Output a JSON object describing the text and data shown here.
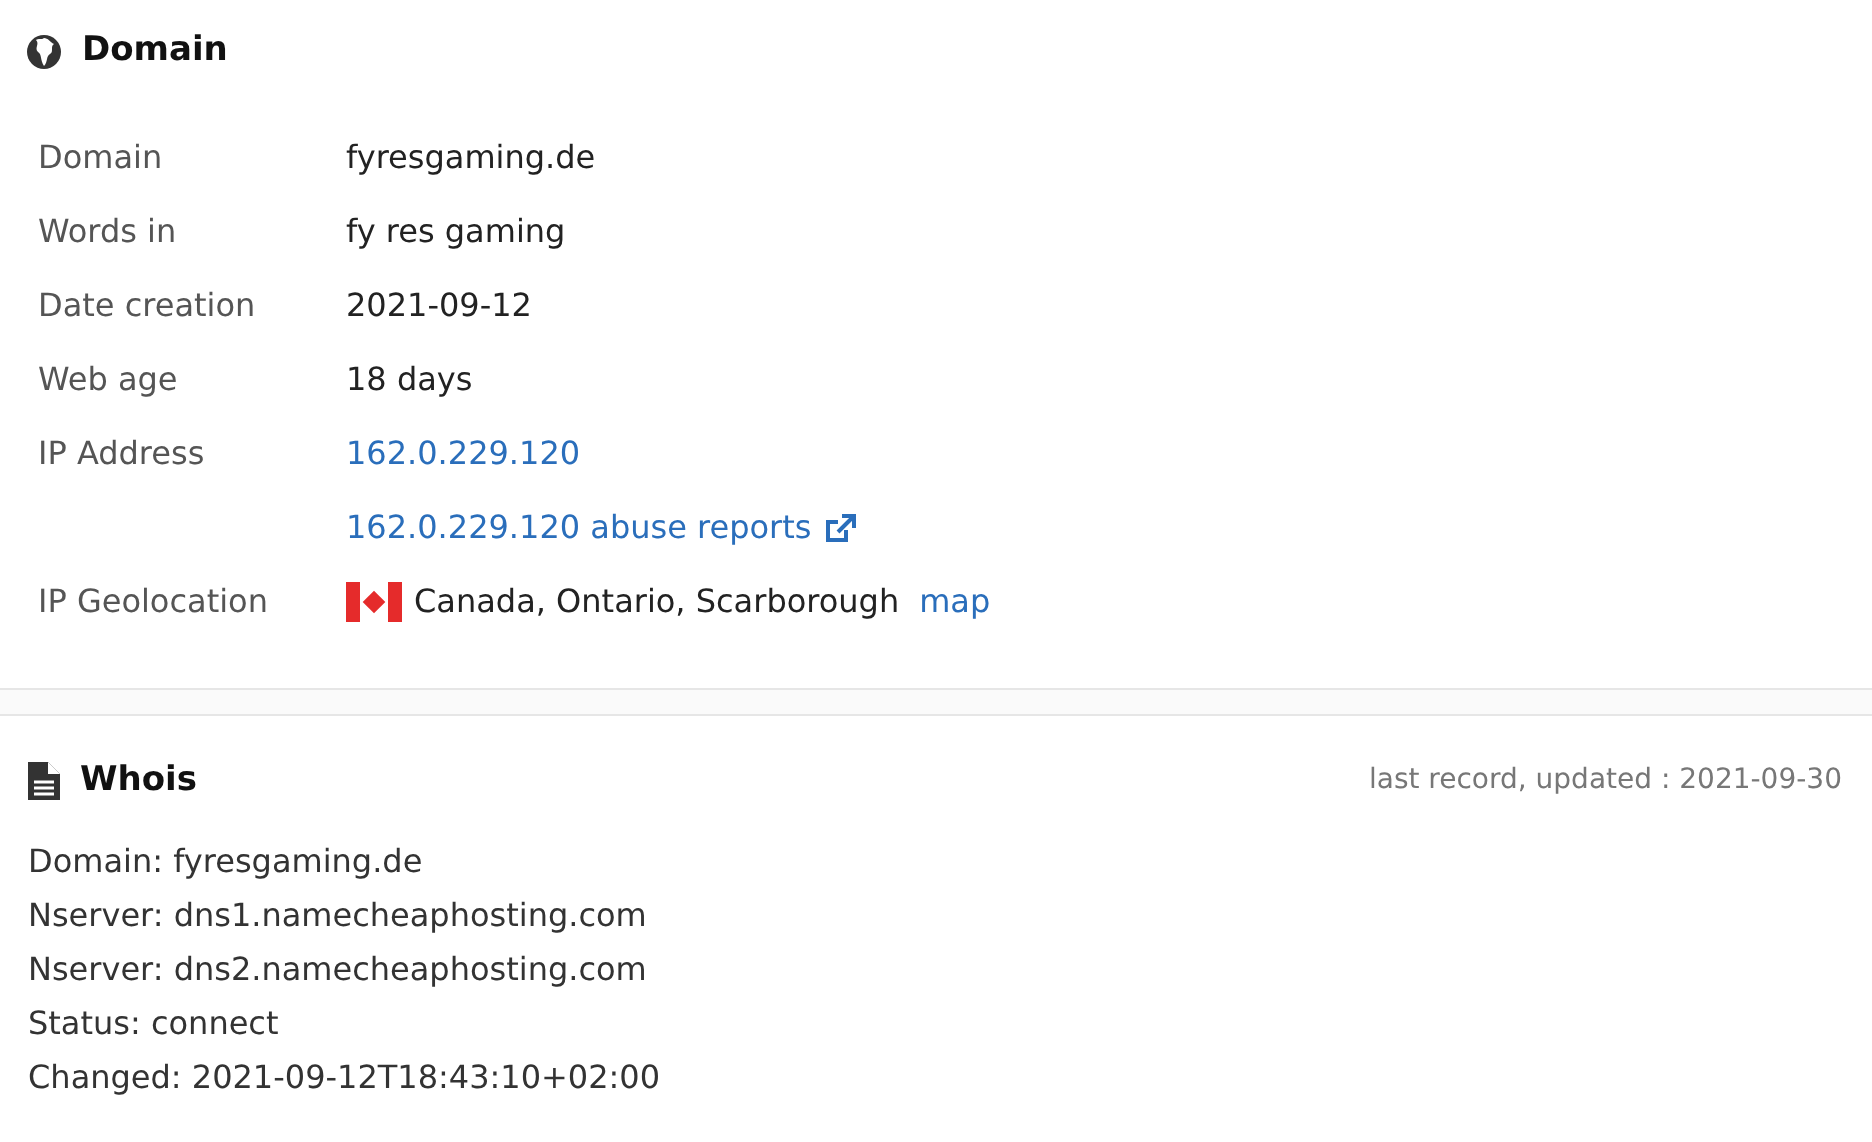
{
  "domain_section": {
    "title": "Domain",
    "rows": [
      {
        "label": "Domain",
        "value": "fyresgaming.de",
        "kind": "text"
      },
      {
        "label": "Words in",
        "value": "fy res gaming",
        "kind": "text"
      },
      {
        "label": "Date creation",
        "value": "2021-09-12",
        "kind": "text"
      },
      {
        "label": "Web age",
        "value": "18 days",
        "kind": "text"
      },
      {
        "label": "IP Address",
        "value": "162.0.229.120",
        "kind": "link"
      },
      {
        "value": "162.0.229.120 abuse reports",
        "kind": "external_link"
      },
      {
        "label": "IP Geolocation",
        "value": "Canada, Ontario, Scarborough",
        "link": "map",
        "kind": "geo"
      }
    ]
  },
  "whois_section": {
    "title": "Whois",
    "updated": "last record, updated : 2021-09-30",
    "lines": [
      "Domain: fyresgaming.de",
      "Nserver: dns1.namecheaphosting.com",
      "Nserver: dns2.namecheaphosting.com",
      "Status: connect",
      "Changed: 2021-09-12T18:43:10+02:00"
    ]
  }
}
